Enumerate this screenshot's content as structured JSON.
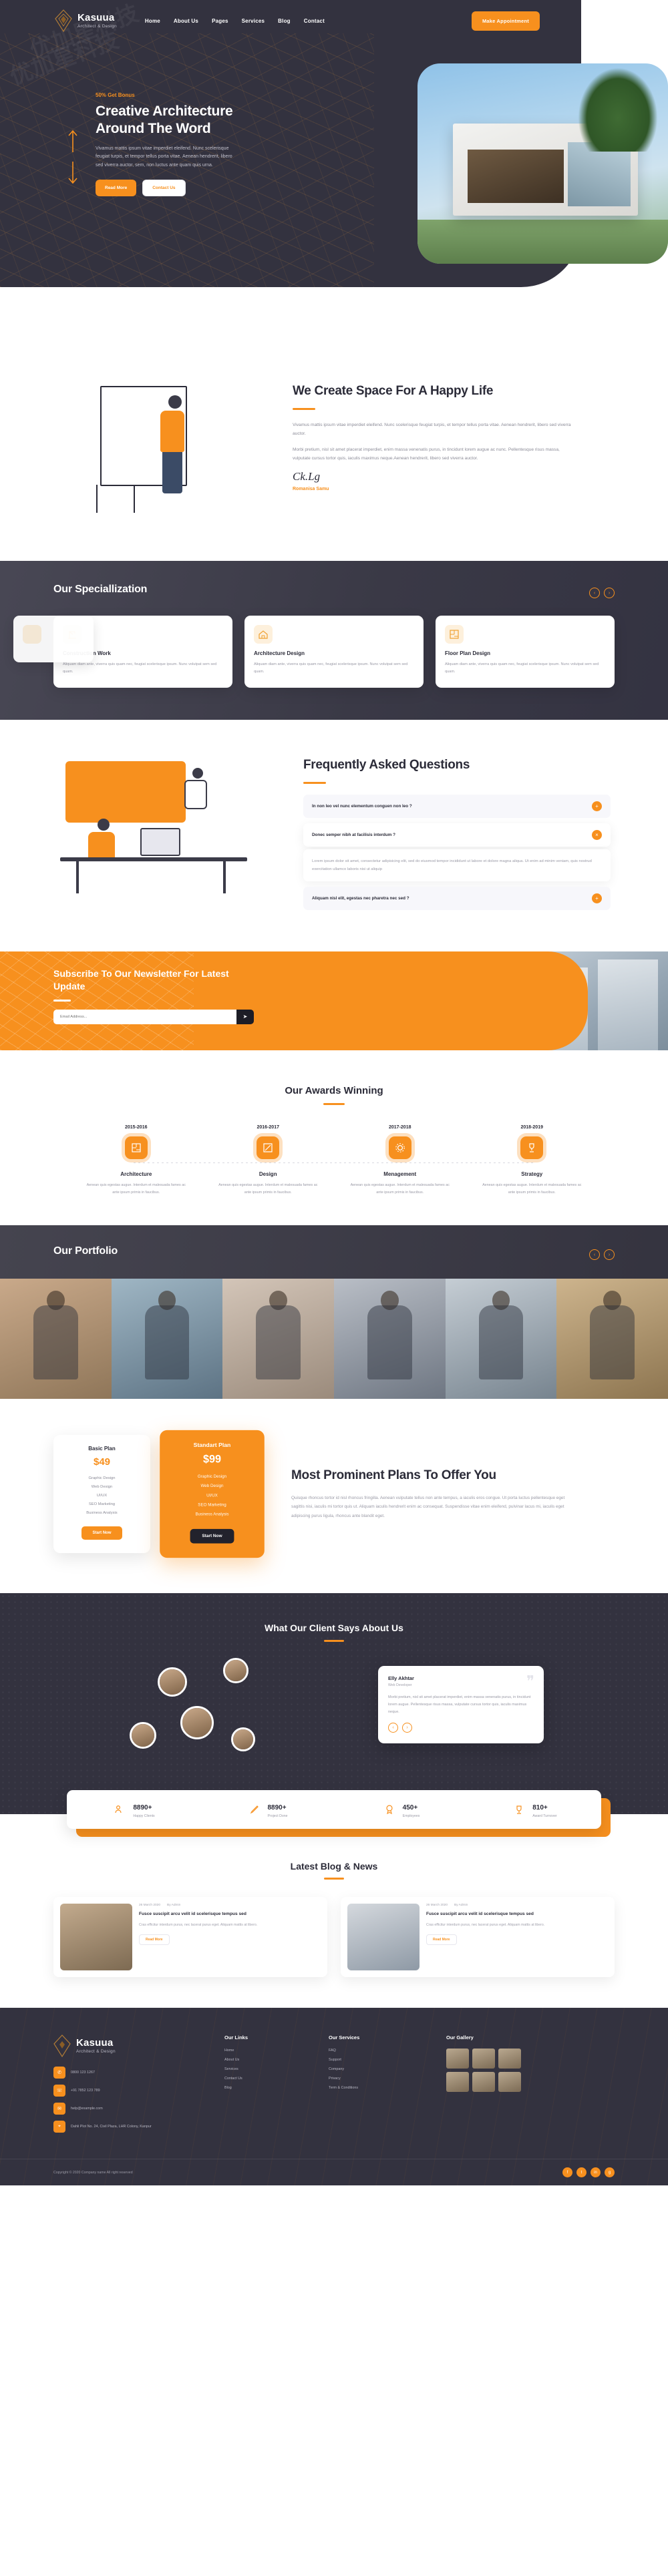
{
  "brand": {
    "name": "Kasuua",
    "tagline": "Architect & Design"
  },
  "header": {
    "nav": [
      {
        "label": "Home"
      },
      {
        "label": "About Us"
      },
      {
        "label": "Pages"
      },
      {
        "label": "Services"
      },
      {
        "label": "Blog"
      },
      {
        "label": "Contact"
      }
    ],
    "cta": "Make Appointment"
  },
  "hero": {
    "badge": "50% Get Bonus",
    "title": "Creative Architecture Around The Word",
    "paragraph": "Vivamus mattis ipsum vitae imperdiet eleifend. Nunc scelerisque feugiat turpis, et tempor tellus porta vitae. Aenean hendrerit, libero sed viverra auctor, sem, non luctus ante quam quis urna.",
    "btn_primary": "Read More",
    "btn_outline": "Contact Us"
  },
  "about": {
    "title": "We Create Space For A Happy Life",
    "p1": "Vivamus mattis ipsum vitae imperdiet eleifend. Nunc scelerisque feugiat turpis, et tempor tellus porta vitae. Aenean hendrerit, libero sed viverra auctor.",
    "p2": "Morbi pretium, nisl sit amet placerat imperdiet, enim massa venenatis purus, in tincidunt lorem augue ac nunc. Pellentesque risus massa, vulputate cursus tortor quis, iaculis maximus neque.Aenean hendrerit, libero sed viverra auctor.",
    "signature_name": "Romanisa Samu"
  },
  "specialization": {
    "title": "Our Speciallization",
    "prev": "‹",
    "next": "›",
    "cards": [
      {
        "title": "Construction Work",
        "text": "Aliquam diam ante, viverra quis quam nec, feugiat scelerisque ipsum. Nunc volutpat sem sed quam.",
        "icon": "crane-icon"
      },
      {
        "title": "Architecture Design",
        "text": "Aliquam diam ante, viverra quis quam nec, feugiat scelerisque ipsum. Nunc volutpat sem sed quam.",
        "icon": "blueprint-house-icon"
      },
      {
        "title": "Floor Plan Design",
        "text": "Aliquam diam ante, viverra quis quam nec, feugiat scelerisque ipsum. Nunc volutpat sem sed quam.",
        "icon": "floorplan-icon"
      }
    ]
  },
  "faq": {
    "title": "Frequently Asked Questions",
    "items": [
      {
        "q": "In non leo vel nunc elementum conguen non leo ?",
        "open": false,
        "toggle": "+"
      },
      {
        "q": "Donec semper nibh at facilisis interdum ?",
        "open": true,
        "toggle": "×",
        "a": "Lorem ipsum dolor sit amet, consectetur adipisicing elit, sed do eiusmod tempor incididunt ut labore et dolore magna aliqua. Ut enim ad minim veniam, quis nostrud exercitation ullamco laboris nisi ut aliquip"
      },
      {
        "q": "Aliquam nisl elit, egestas nec pharetra nec sed ?",
        "open": false,
        "toggle": "+"
      }
    ]
  },
  "newsletter": {
    "title": "Subscribe To Our Newsletter For Latest Update",
    "placeholder": "Email Address...",
    "send_icon": "send-icon"
  },
  "awards": {
    "title": "Our Awards Winning",
    "items": [
      {
        "year": "2015-2016",
        "name": "Architecture",
        "text": "Aenean quis egestas augue. Interdum et malesuada fames ac ante ipsum primis in faucibus.",
        "icon": "floorplan-award-icon"
      },
      {
        "year": "2016-2017",
        "name": "Design",
        "text": "Aenean quis egestas augue. Interdum et malesuada fames ac ante ipsum primis in faucibus.",
        "icon": "pencil-ruler-icon"
      },
      {
        "year": "2017-2018",
        "name": "Menagement",
        "text": "Aenean quis egestas augue. Interdum et malesuada fames ac ante ipsum primis in faucibus.",
        "icon": "gear-icon"
      },
      {
        "year": "2018-2019",
        "name": "Strategy",
        "text": "Aenean quis egestas augue. Interdum et malesuada fames ac ante ipsum primis in faucibus.",
        "icon": "trophy-icon"
      }
    ]
  },
  "portfolio": {
    "title": "Our Portfolio",
    "prev": "‹",
    "next": "›",
    "items": 6
  },
  "pricing": {
    "title": "Most Prominent Plans To Offer You",
    "paragraph": "Quisque rhoncus tortor id nisl rhoncus fringilla. Aenean vulputate tellus non ante tempus, a iaculis eros congue. Ut porta luctus pellentesque eget sagittis nisi, iaculis mi tortor quis ut.  Aliquam iaculis hendrerit enim ac consequat. Suspendisse vitae enim eleifend, pulvinar lacus mi, iaculis eget adipiscing purus ligula, rhoncus ante blandit eget.",
    "plans": [
      {
        "name": "Basic Plan",
        "price": "$49",
        "featured": false,
        "cta": "Start Now",
        "features": [
          "Graphic Design",
          "Web Design",
          "UI/UX",
          "SEO Marketing",
          "Business Analysis"
        ]
      },
      {
        "name": "Standart Plan",
        "price": "$99",
        "featured": true,
        "cta": "Start Now",
        "features": [
          "Graphic Design",
          "Web Design",
          "UI/UX",
          "SEO Marketing",
          "Business Analysis"
        ]
      }
    ]
  },
  "testimonial": {
    "title": "What Our Client Says About Us",
    "name": "Elly Akhtar",
    "role": "Web Developer",
    "text": "Morbi pretium, nisl sit amet placerat imperdiet, enim massa venenatis purus, in tincidunt lorem augue. Pellentesque risus massa, vulputate cursus tortor quis, iaculis maximus neque.",
    "prev": "‹",
    "next": "›"
  },
  "stats": [
    {
      "num": "8890+",
      "label": "Happy Clients",
      "icon": "users-icon"
    },
    {
      "num": "8890+",
      "label": "Project Done",
      "icon": "pencil-icon"
    },
    {
      "num": "450+",
      "label": "Employees",
      "icon": "badge-icon"
    },
    {
      "num": "810+",
      "label": "Award Turnover",
      "icon": "award-icon"
    }
  ],
  "blog": {
    "title": "Latest Blog & News",
    "posts": [
      {
        "date": "26 March 2020",
        "author": "By Admin",
        "title": "Fusce suscipit arcu velit id scelerisque tempus sed",
        "text": "Cras efficitur interdum purus, nec lacerat purus eget. Aliquam mattis at libero.",
        "more": "Read More"
      },
      {
        "date": "26 March 2020",
        "author": "By Admin",
        "title": "Fusce suscipit arcu velit id scelerisque tempus sed",
        "text": "Cras efficitur interdum purus, nec lacerat purus eget. Aliquam mattis at libero.",
        "more": "Read More"
      }
    ]
  },
  "footer": {
    "contacts": [
      {
        "icon": "phone-icon",
        "text": "0800 123 1267"
      },
      {
        "icon": "fax-icon",
        "text": "+91 7852 123 789"
      },
      {
        "icon": "mail-icon",
        "text": "help@example.com"
      },
      {
        "icon": "map-icon",
        "text": "Dahli Plot No. 24, Civil Plaza, LHR Colony, Kanpur"
      }
    ],
    "links_title": "Our Links",
    "links": [
      "Home",
      "About Us",
      "Services",
      "Contact Us",
      "Blog"
    ],
    "services_title": "Our Services",
    "services": [
      "FAQ",
      "Support",
      "Company",
      "Privacy",
      "Term & Conditions"
    ],
    "gallery_title": "Our Gallery",
    "gallery_count": 6,
    "copyright": "Copyright © 2020 Company name All right reserved",
    "socials": [
      "f",
      "t",
      "in",
      "g"
    ]
  }
}
